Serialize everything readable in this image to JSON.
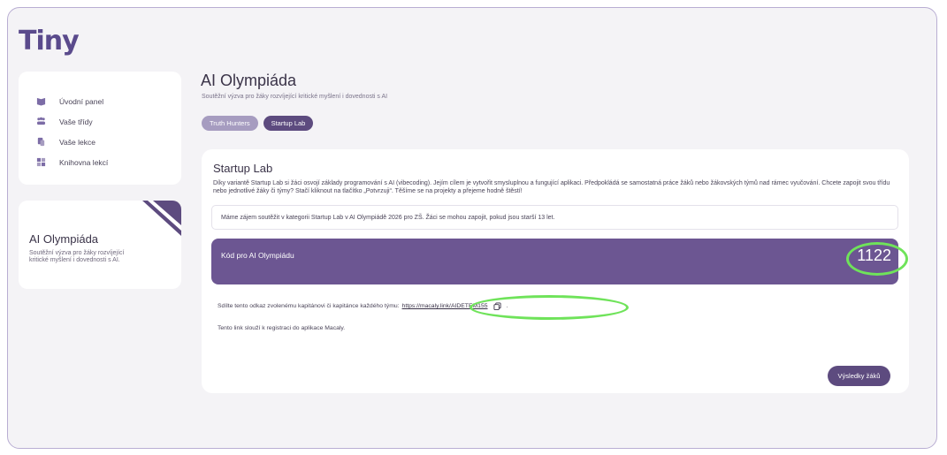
{
  "app": {
    "logo": "Tiny"
  },
  "sidebar": {
    "items": [
      {
        "label": "Úvodní panel",
        "icon": "dashboard-icon"
      },
      {
        "label": "Vaše třídy",
        "icon": "people-icon"
      },
      {
        "label": "Vaše lekce",
        "icon": "lesson-icon"
      },
      {
        "label": "Knihovna lekcí",
        "icon": "library-icon"
      }
    ],
    "promo": {
      "title": "AI Olympiáda",
      "text": "Soutěžní výzva pro žáky rozvíjející kritické myšlení i dovednosti s AI."
    }
  },
  "header": {
    "title": "AI Olympiáda",
    "subtitle": "Soutěžní výzva pro žáky rozvíjející kritické myšlení i dovednosti s AI",
    "tabs": [
      {
        "label": "Truth Hunters",
        "active": false
      },
      {
        "label": "Startup Lab",
        "active": true
      }
    ]
  },
  "main": {
    "title": "Startup Lab",
    "description": "Díky variantě Startup Lab si žáci osvojí základy programování s AI (vibecoding). Jejím cílem je vytvořit smysluplnou a fungující aplikaci. Předpokládá se samostatná práce žáků nebo žákovských týmů nad rámec vyučování. Chcete zapojit svou třídu nebo jednotlivé žáky či týmy? Stačí kliknout na tlačítko „Potvrzuji“. Těšíme se na projekty a přejeme hodně štěstí!",
    "notice": "Máme zájem soutěžit v kategorii Startup Lab v AI Olympiádě 2026 pro ZŠ. Žáci se mohou zapojit, pokud jsou starší 13 let.",
    "code_label": "Kód pro AI Olympiádu",
    "code_value": "1122",
    "share_text": "Sdílte tento odkaz zvolenému kapitánovi či kapitánce každého týmu:",
    "share_link": "https://macaly.link/AIDETEM155",
    "share_suffix": ".",
    "register_text": "Tento link slouží k registraci do aplikace Macaly.",
    "results_button": "Výsledky žáků"
  },
  "colors": {
    "accent": "#5d4b7f",
    "code_bar": "#6c5692",
    "tab_inactive": "#a69cc0",
    "highlight": "#6fe35a"
  }
}
